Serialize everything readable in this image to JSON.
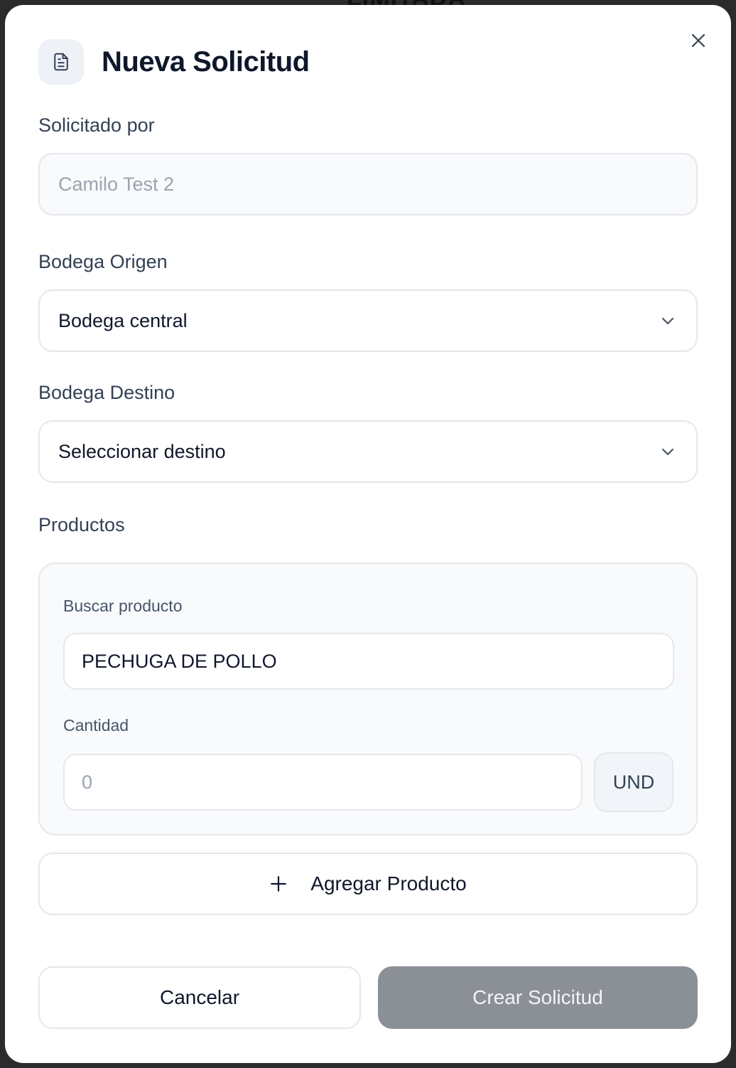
{
  "background": {
    "partial_text": "LIMITADA"
  },
  "dialog": {
    "title": "Nueva Solicitud",
    "icon": "file-text-icon",
    "close_icon": "close-icon"
  },
  "form": {
    "requested_by": {
      "label": "Solicitado por",
      "value": "Camilo Test 2"
    },
    "origin": {
      "label": "Bodega Origen",
      "selected": "Bodega central"
    },
    "destination": {
      "label": "Bodega Destino",
      "selected": "Seleccionar destino"
    },
    "products": {
      "label": "Productos",
      "search_label": "Buscar producto",
      "search_value": "PECHUGA DE POLLO",
      "quantity_label": "Cantidad",
      "quantity_placeholder": "0",
      "unit": "UND"
    },
    "add_product_label": "Agregar Producto"
  },
  "actions": {
    "cancel_label": "Cancelar",
    "create_label": "Crear Solicitud"
  },
  "colors": {
    "primary_disabled": "#8b8f96",
    "border": "#e5e7eb",
    "title": "#0f172a"
  }
}
